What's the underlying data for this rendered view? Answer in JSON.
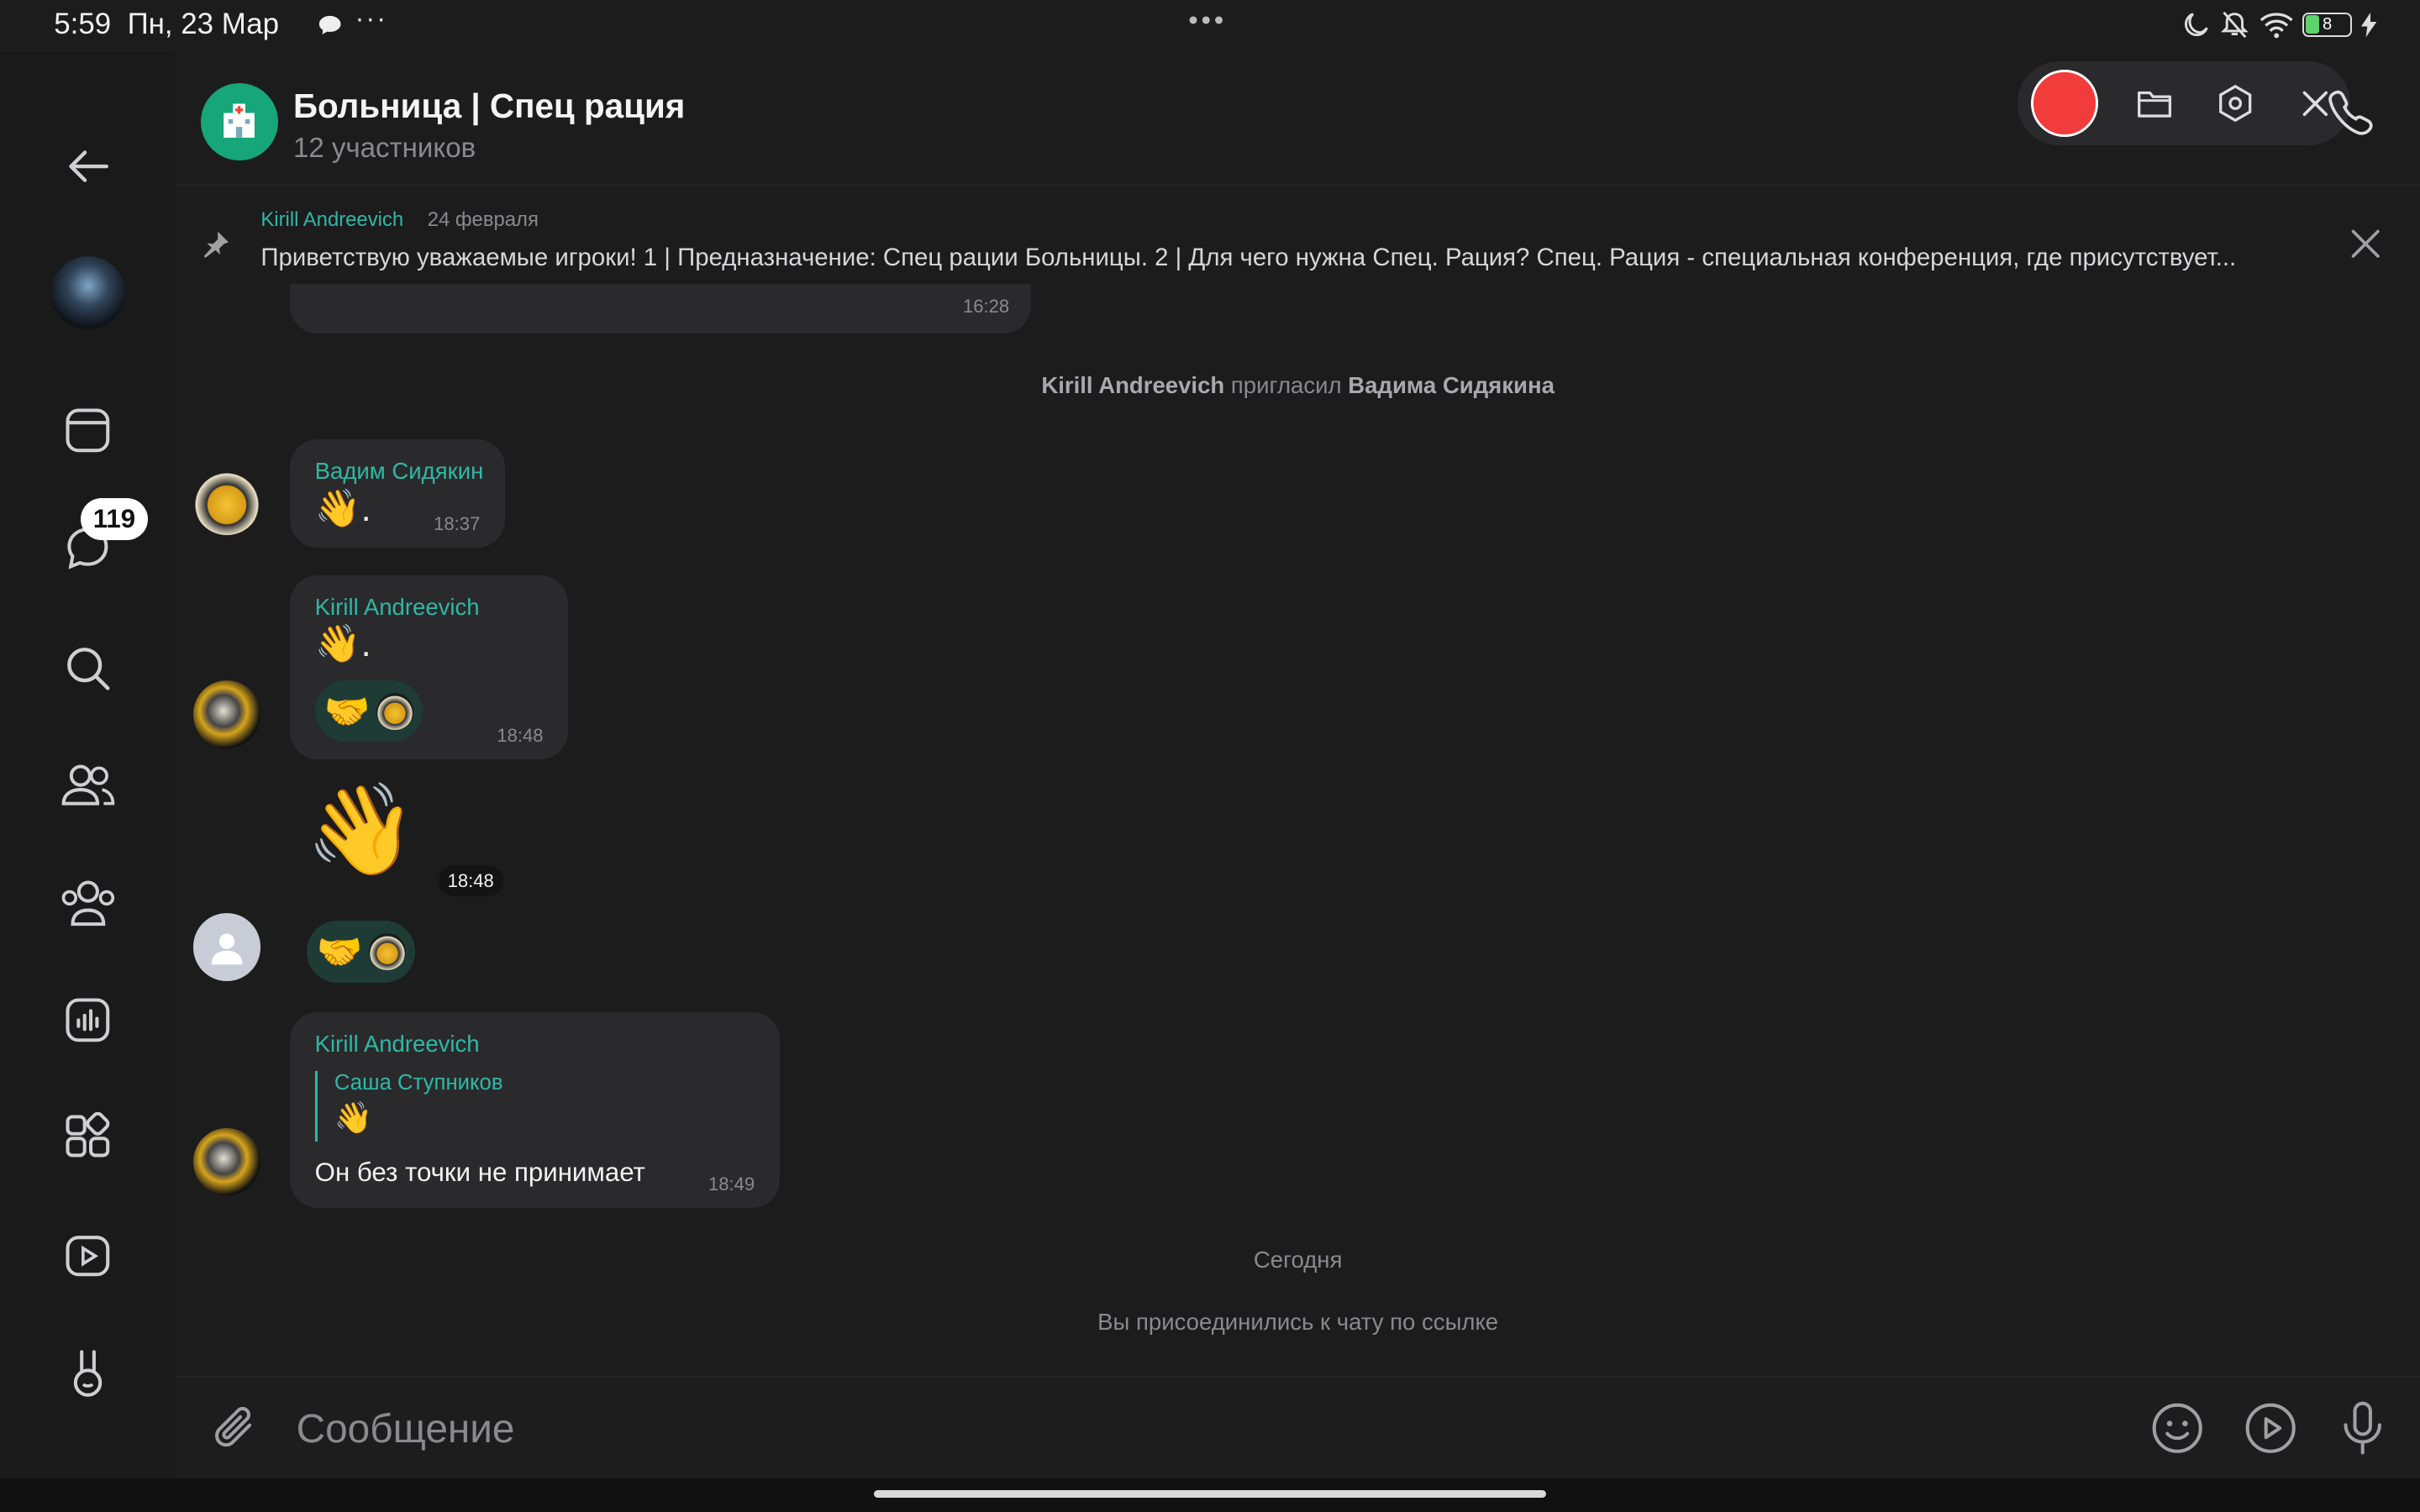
{
  "status_bar": {
    "time": "5:59",
    "date": "Пн, 23 Мар",
    "center": "•••",
    "battery": "8"
  },
  "rail": {
    "badge": "119"
  },
  "header": {
    "title": "Больница | Спец рация",
    "subtitle": "12 участников"
  },
  "pinned": {
    "author": "Kirill Andreevich",
    "date": "24 февраля",
    "text": "Приветствую уважаемые игроки!   1 | Предназначение:   Спец рации Больницы.   2 | Для чего нужна Спец. Рация?  Спец. Рация - специальная конференция, где присутствует..."
  },
  "messages": {
    "m0_time": "16:28",
    "service1_actor": "Kirill Andreevich",
    "service1_action": "пригласил",
    "service1_target": "Вадима Сидякина",
    "m1_sender": "Вадим Сидякин",
    "m1_text": "👋.",
    "m1_time": "18:37",
    "m2_sender": "Kirill Andreevich",
    "m2_text": "👋.",
    "m2_time": "18:48",
    "m2_reaction": "🤝",
    "m3_sticker": "👋",
    "m3_time": "18:48",
    "m3_reaction": "🤝",
    "m4_sender": "Kirill Andreevich",
    "m4_reply_sender": "Саша Ступников",
    "m4_reply_text": "👋",
    "m4_text": "Он без точки не принимает",
    "m4_time": "18:49",
    "date_sep": "Сегодня",
    "service2": "Вы присоединились к чату по ссылке"
  },
  "composer": {
    "placeholder": "Сообщение"
  },
  "colors": {
    "accent": "#2fb8a5",
    "record": "#f23b3b",
    "bubble": "#2a2a2c",
    "background": "#1c1c1d"
  }
}
